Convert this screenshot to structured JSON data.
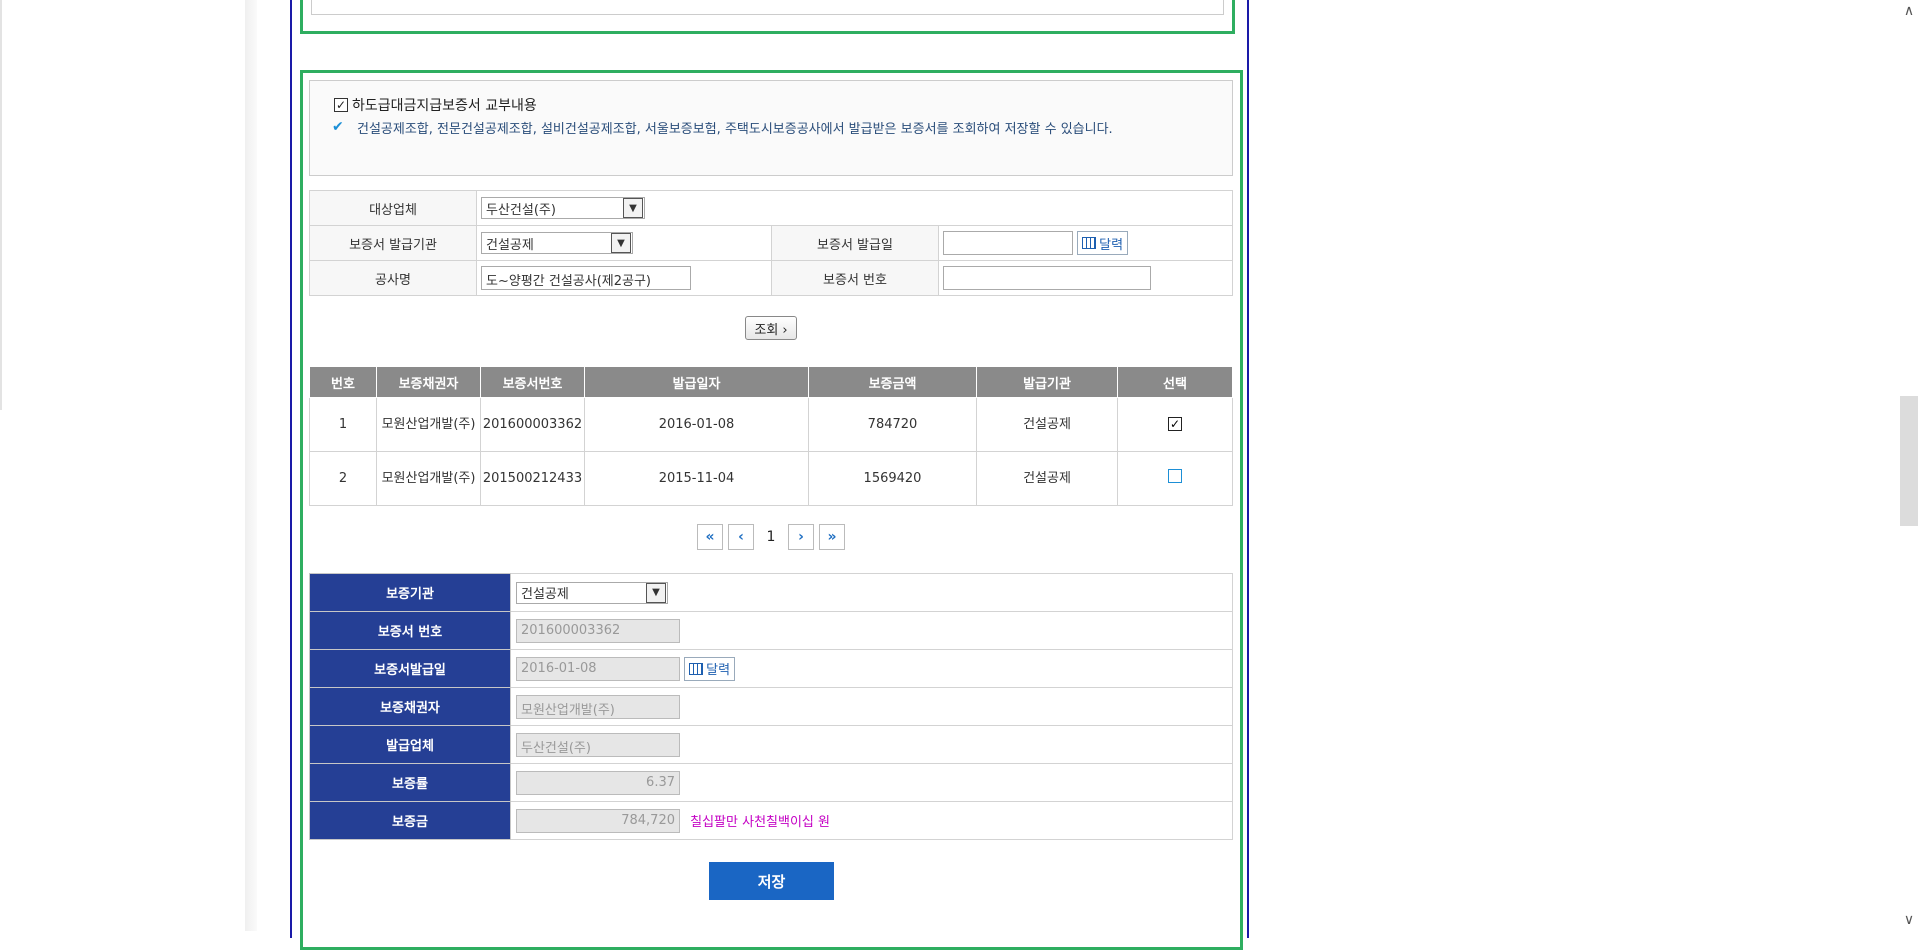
{
  "notice": {
    "title": "하도급대금지급보증서 교부내용",
    "description": "건설공제조합, 전문건설공제조합, 설비건설공제조합, 서울보증보험, 주택도시보증공사에서 발급받은 보증서를 조회하여 저장할 수 있습니다."
  },
  "search": {
    "target_company_label": "대상업체",
    "target_company_value": "두산건설(주)",
    "issuer_label": "보증서 발급기관",
    "issuer_value": "건설공제",
    "issue_date_label": "보증서 발급일",
    "issue_date_value": "",
    "calendar_label": "달력",
    "project_label": "공사명",
    "project_value": "도~양평간 건설공사(제2공구)",
    "cert_no_label": "보증서 번호",
    "cert_no_value": "",
    "search_button": "조회 ›"
  },
  "results": {
    "columns": [
      "번호",
      "보증채권자",
      "보증서번호",
      "발급일자",
      "보증금액",
      "발급기관",
      "선택"
    ],
    "rows": [
      {
        "no": "1",
        "creditor": "모원산업개발(주)",
        "cert_no": "201600003362",
        "date": "2016-01-08",
        "amount": "784720",
        "issuer": "건설공제",
        "selected": true
      },
      {
        "no": "2",
        "creditor": "모원산업개발(주)",
        "cert_no": "201500212433",
        "date": "2015-11-04",
        "amount": "1569420",
        "issuer": "건설공제",
        "selected": false
      }
    ]
  },
  "pager": {
    "first": "«",
    "prev": "‹",
    "current": "1",
    "next": "›",
    "last": "»"
  },
  "detail": {
    "agency_label": "보증기관",
    "agency_value": "건설공제",
    "cert_no_label": "보증서 번호",
    "cert_no_value": "201600003362",
    "issue_date_label": "보증서발급일",
    "issue_date_value": "2016-01-08",
    "calendar_label": "달력",
    "creditor_label": "보증채권자",
    "creditor_value": "모원산업개발(주)",
    "issuer_company_label": "발급업체",
    "issuer_company_value": "두산건설(주)",
    "rate_label": "보증률",
    "rate_value": "6.37",
    "amount_label": "보증금",
    "amount_value": "784,720",
    "amount_korean": "칠십팔만 사천칠백이십 원"
  },
  "save_button": "저장",
  "scrollbar": {
    "up": "∧",
    "down": "∨"
  }
}
